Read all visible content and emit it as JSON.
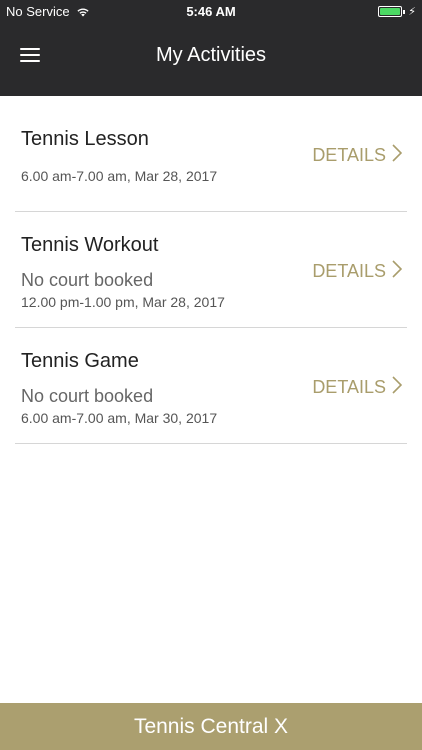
{
  "status_bar": {
    "carrier": "No Service",
    "time": "5:46 AM",
    "battery_level": 1.0
  },
  "nav": {
    "title": "My Activities",
    "menu_icon": "hamburger-menu-icon"
  },
  "activities": [
    {
      "title": "Tennis Lesson",
      "court": "",
      "time": "6.00 am-7.00 am, Mar 28, 2017",
      "details_label": "DETAILS"
    },
    {
      "title": "Tennis Workout",
      "court": "No court booked",
      "time": "12.00 pm-1.00 pm, Mar 28, 2017",
      "details_label": "DETAILS"
    },
    {
      "title": "Tennis Game",
      "court": "No court booked",
      "time": "6.00 am-7.00 am, Mar 30, 2017",
      "details_label": "DETAILS"
    }
  ],
  "footer": {
    "brand": "Tennis Central X"
  },
  "colors": {
    "header_bg": "#2a2a2c",
    "accent_gold": "#ab9f6f",
    "details_text": "#a99d6c",
    "battery_green": "#4cd964"
  }
}
